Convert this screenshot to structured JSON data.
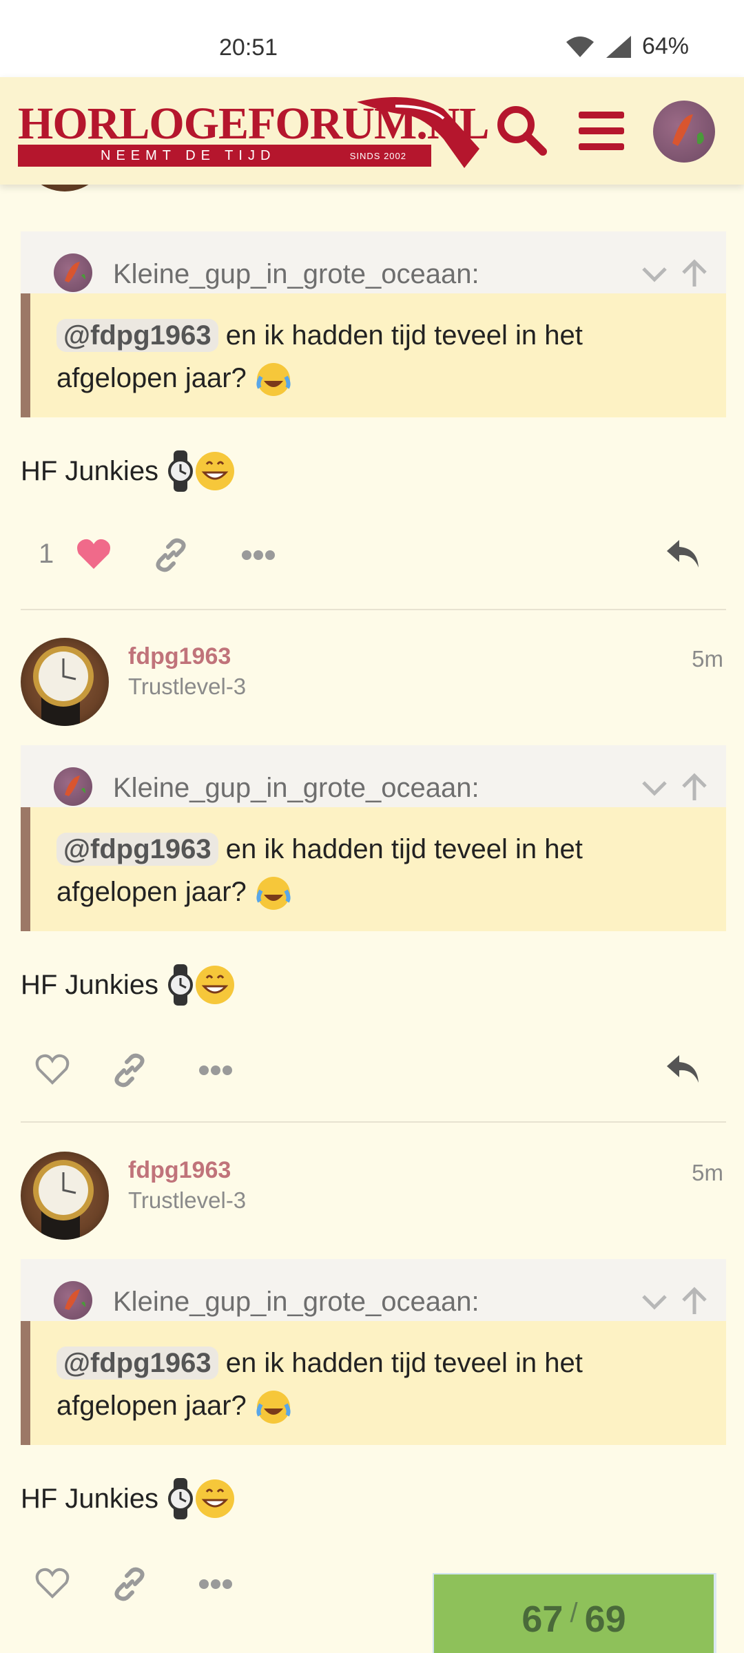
{
  "status_bar": {
    "time": "20:51",
    "battery": "64%"
  },
  "header": {
    "brand": "HORLOGEFORUM.NL",
    "tagline": "NEEMT DE TIJD",
    "since": "SINDS 2002"
  },
  "quote": {
    "author": "Kleine_gup_in_grote_oceaan:",
    "mention": "@fdpg1963",
    "text_line1": " en ik hadden tijd teveel in het",
    "text_line2": "afgelopen jaar?"
  },
  "post_body": "HF Junkies",
  "posts": [
    {
      "likes": "1"
    },
    {
      "username": "fdpg1963",
      "level": "Trustlevel-3",
      "time": "5m"
    },
    {
      "username": "fdpg1963",
      "level": "Trustlevel-3",
      "time": "5m"
    }
  ],
  "progress": {
    "current": "67",
    "separator": "/",
    "total": "69"
  },
  "colors": {
    "accent": "#b5162d",
    "like": "#f06a8a",
    "progress": "#8ec15a"
  },
  "icons": [
    "wifi-icon",
    "signal-icon",
    "battery-icon",
    "search-icon",
    "menu-icon",
    "avatar",
    "chevron-down-icon",
    "arrow-up-icon",
    "heart-icon",
    "link-icon",
    "more-icon",
    "reply-icon",
    "watch-emoji",
    "grin-emoji",
    "laugh-cry-emoji"
  ]
}
